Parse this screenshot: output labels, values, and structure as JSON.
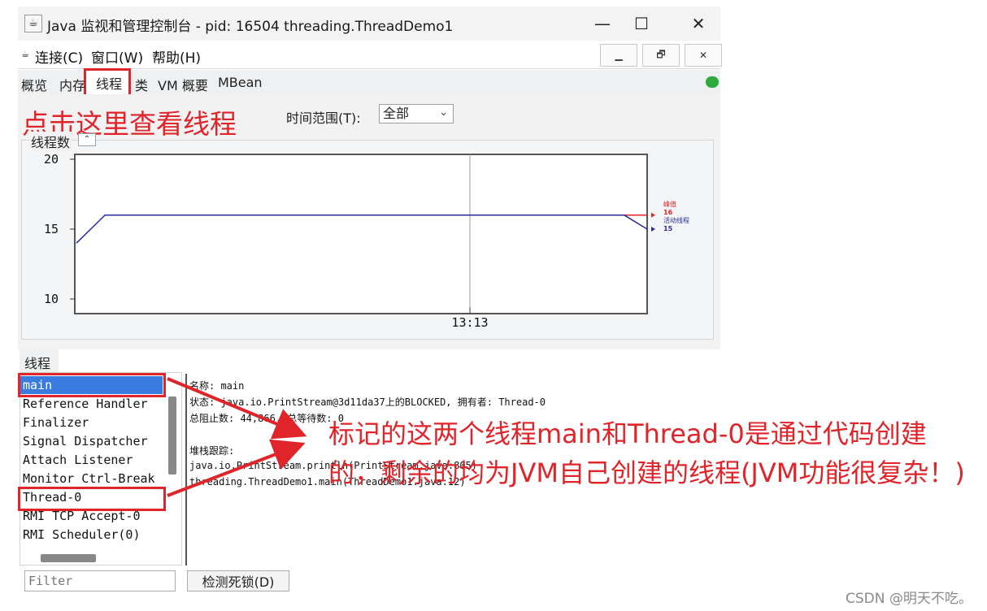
{
  "window": {
    "title": "Java 监视和管理控制台 - pid: 16504 threading.ThreadDemo1",
    "minimize_glyph": "—",
    "maximize_glyph": "☐",
    "close_glyph": "✕"
  },
  "menu": {
    "items": [
      "连接(C)",
      "窗口(W)",
      "帮助(H)"
    ],
    "inner_buttons": [
      "▁",
      "🗗",
      "✕"
    ]
  },
  "tabs": [
    "概览",
    "内存",
    "线程",
    "类",
    "VM 概要",
    "MBean"
  ],
  "selected_tab": "线程",
  "annotations": {
    "tab_hint": "点击这里查看线程",
    "explanation": "标记的这两个线程main和Thread-0是通过代码创建的，剩余的均为JVM自己创建的线程(JVM功能很复杂！)"
  },
  "time_range": {
    "label": "时间范围(T):",
    "value": "全部"
  },
  "chart_panel_title": "线程数",
  "chart_data": {
    "type": "line",
    "ylim": [
      10,
      20
    ],
    "yticks": [
      20,
      15,
      10
    ],
    "x_tick_label": "13:13",
    "series": [
      {
        "name": "峰值",
        "value_label": "16",
        "color": "#e0242a",
        "x": [
          0.05,
          0.96,
          1.0
        ],
        "values": [
          16,
          16,
          16
        ]
      },
      {
        "name": "活动线程",
        "value_label": "15",
        "color": "#2a2aa0",
        "x": [
          0.0,
          0.05,
          0.96,
          1.0
        ],
        "values": [
          14,
          16,
          16,
          15
        ]
      }
    ]
  },
  "threads_section_label": "线程",
  "threads": [
    "main",
    "Reference Handler",
    "Finalizer",
    "Signal Dispatcher",
    "Attach Listener",
    "Monitor Ctrl-Break",
    "Thread-0",
    "RMI TCP Accept-0",
    "RMI Scheduler(0)"
  ],
  "selected_thread": "main",
  "details": {
    "name_line": "名称: main",
    "state_line": "状态: java.io.PrintStream@3d11da37上的BLOCKED, 拥有者: Thread-0",
    "blocked_line": "总阻止数: 44,866, 总等待数: 0",
    "stack_label": "堆栈跟踪:",
    "stack": [
      "java.io.PrintStream.println(PrintStream.java:805)",
      "threading.ThreadDemo1.main(ThreadDemo1.java:12)"
    ]
  },
  "filter_placeholder": "Filter",
  "deadlock_button": "检测死锁(D)",
  "watermark": "CSDN @明天不吃。",
  "colors": {
    "annotation_red": "#e0242a",
    "selection_blue": "#3a7be0",
    "active_series": "#2a2aa0"
  }
}
